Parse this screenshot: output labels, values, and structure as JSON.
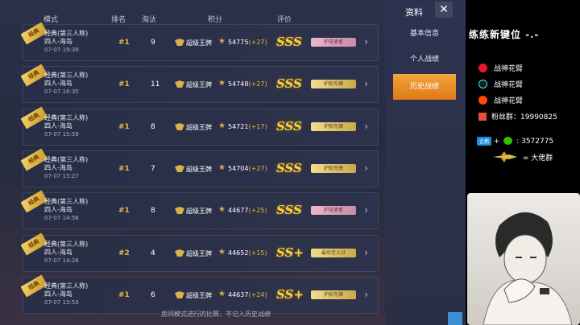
{
  "header": {
    "mode": "模式",
    "rank": "排名",
    "elim": "淘汰",
    "score": "积分",
    "rating": "评价"
  },
  "side": {
    "title": "资料",
    "close": "✕",
    "nav": [
      "基本信息",
      "个人战绩",
      "历史战绩"
    ],
    "active_index": 2
  },
  "matches": [
    {
      "ribbon": "经典",
      "mode_line1": "经典(第三人称)",
      "mode_line2": "四人-海岛",
      "date": "07-07 19:39",
      "rank": "#1",
      "elim": "9",
      "tier": "超级王牌",
      "score": "54775",
      "delta": "(+27)",
      "grade": "SSS",
      "badge": "护花使者",
      "badge_style": "pink"
    },
    {
      "ribbon": "经典",
      "mode_line1": "经典(第三人称)",
      "mode_line2": "四人-海岛",
      "date": "07-07 16:35",
      "rank": "#1",
      "elim": "11",
      "tier": "超级王牌",
      "score": "54748",
      "delta": "(+27)",
      "grade": "SSS",
      "badge": "护航先锋",
      "badge_style": "gold"
    },
    {
      "ribbon": "经典",
      "mode_line1": "经典(第三人称)",
      "mode_line2": "四人-海岛",
      "date": "07-07 15:59",
      "rank": "#1",
      "elim": "8",
      "tier": "超级王牌",
      "score": "54721",
      "delta": "(+17)",
      "grade": "SSS",
      "badge": "护航先锋",
      "badge_style": "gold"
    },
    {
      "ribbon": "经典",
      "mode_line1": "经典(第三人称)",
      "mode_line2": "四人-海岛",
      "date": "07-07 15:27",
      "rank": "#1",
      "elim": "7",
      "tier": "超级王牌",
      "score": "54704",
      "delta": "(+27)",
      "grade": "SSS",
      "badge": "护航先锋",
      "badge_style": "gold"
    },
    {
      "ribbon": "经典",
      "mode_line1": "经典(第三人称)",
      "mode_line2": "四人-海岛",
      "date": "07-07 14:56",
      "rank": "#1",
      "elim": "8",
      "tier": "超级王牌",
      "score": "44677",
      "delta": "(+25)",
      "grade": "SSS",
      "badge": "护花使者",
      "badge_style": "pink"
    },
    {
      "ribbon": "经典",
      "mode_line1": "经典(第三人称)",
      "mode_line2": "四人-海岛",
      "date": "07-07 14:26",
      "rank": "#2",
      "elim": "4",
      "tier": "超级王牌",
      "score": "44652",
      "delta": "(+15)",
      "grade": "SS+",
      "badge": "最后至上分",
      "badge_style": "gold"
    },
    {
      "ribbon": "经典",
      "mode_line1": "经典(第三人称)",
      "mode_line2": "四人-海岛",
      "date": "07-07 13:53",
      "rank": "#1",
      "elim": "6",
      "tier": "超级王牌",
      "score": "44637",
      "delta": "(+24)",
      "grade": "SS+",
      "badge": "护航先锋",
      "badge_style": "gold"
    }
  ],
  "footnote": "房间模式进行的比赛，不记入历史战绩",
  "overlay": {
    "title": "练练新键位 -.-",
    "weibo": "战神花臂",
    "douyin": "战神花臂",
    "kuaishou": "战神花臂",
    "fans_label": "粉丝群：",
    "fans_number": "19990825",
    "contact_tag": "企鹅",
    "contact_plus": "+",
    "contact_number": ": 3572775",
    "boss_label": "= 大佬群"
  },
  "colors": {
    "accent_orange": "#f2a53c",
    "rank_gold": "#e0b84a",
    "grade_gold": "#f4d24a",
    "delta_orange": "#f0b43a"
  }
}
